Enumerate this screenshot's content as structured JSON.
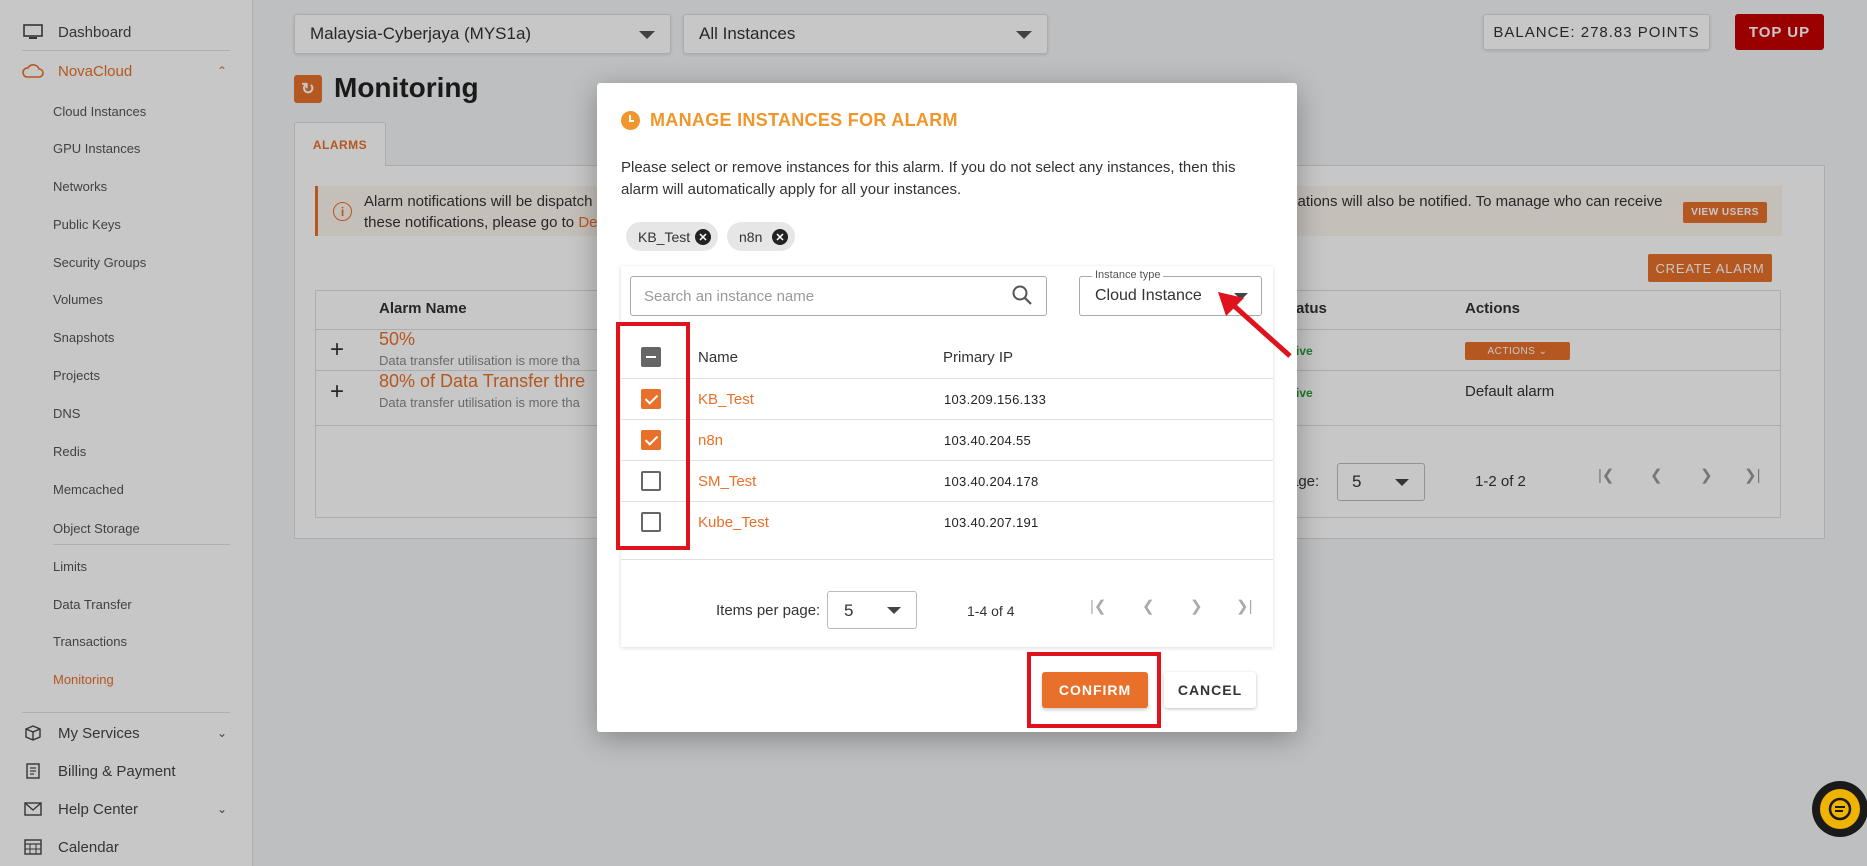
{
  "sidebar": {
    "dashboard": "Dashboard",
    "novacloud": "NovaCloud",
    "items": [
      "Cloud Instances",
      "GPU Instances",
      "Networks",
      "Public Keys",
      "Security Groups",
      "Volumes",
      "Snapshots",
      "Projects",
      "DNS",
      "Redis",
      "Memcached",
      "Object Storage",
      "Limits",
      "Data Transfer",
      "Transactions",
      "Monitoring"
    ],
    "my_services": "My Services",
    "billing": "Billing & Payment",
    "help": "Help Center",
    "calendar": "Calendar"
  },
  "topbar": {
    "region": "Malaysia-Cyberjaya (MYS1a)",
    "instances": "All Instances",
    "balance": "BALANCE: 278.83 POINTS",
    "topup": "TOP UP"
  },
  "page": {
    "title": "Monitoring",
    "tab": "ALARMS",
    "info_line1_left": "Alarm notifications will be dispatch",
    "info_line1_right": "cations will also be notified. To manage who can receive",
    "info_line2_left": "these notifications, please go to ",
    "info_line2_link": "De",
    "view_users": "VIEW USERS",
    "create_alarm": "CREATE ALARM",
    "col_alarm_name": "Alarm Name",
    "col_status": "atus",
    "col_actions": "Actions",
    "rows": [
      {
        "name": "50%",
        "desc": "Data transfer utilisation is more tha",
        "status": "ive",
        "action": "ACTIONS"
      },
      {
        "name": "80% of Data Transfer thre",
        "desc": "Data transfer utilisation is more tha",
        "status": "ive",
        "action": "Default alarm"
      }
    ],
    "per_page_label": "age:",
    "per_page_value": "5",
    "range": "1-2 of 2"
  },
  "modal": {
    "title": "MANAGE INSTANCES FOR ALARM",
    "desc_line1": "Please select or remove instances for this alarm. If you do not select any instances, then this",
    "desc_line2": "alarm will automatically apply for all your instances.",
    "chips": [
      "KB_Test",
      "n8n"
    ],
    "search_placeholder": "Search an instance name",
    "instance_type_label": "Instance type",
    "instance_type_value": "Cloud Instance",
    "col_name": "Name",
    "col_ip": "Primary IP",
    "instances": [
      {
        "name": "KB_Test",
        "ip": "103.209.156.133",
        "checked": true
      },
      {
        "name": "n8n",
        "ip": "103.40.204.55",
        "checked": true
      },
      {
        "name": "SM_Test",
        "ip": "103.40.204.178",
        "checked": false
      },
      {
        "name": "Kube_Test",
        "ip": "103.40.207.191",
        "checked": false
      }
    ],
    "items_per_page_label": "Items per page:",
    "items_per_page_value": "5",
    "range": "1-4 of 4",
    "confirm": "CONFIRM",
    "cancel": "CANCEL"
  },
  "colors": {
    "accent": "#e8702a",
    "title_orange": "#f0962b",
    "topup_red": "#c70000",
    "highlight_red": "#e0131c"
  }
}
